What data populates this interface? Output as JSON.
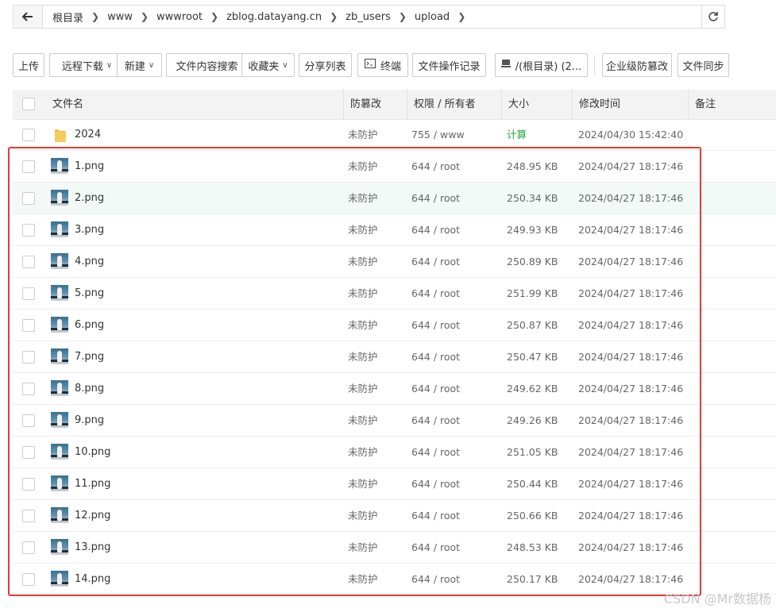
{
  "breadcrumb": {
    "items": [
      "根目录",
      "www",
      "wwwroot",
      "zblog.datayang.cn",
      "zb_users",
      "upload"
    ]
  },
  "toolbar": {
    "upload": "上传",
    "remote_download": "远程下载",
    "new": "新建",
    "content_search": "文件内容搜索",
    "favorites": "收藏夹",
    "share_list": "分享列表",
    "terminal": "终端",
    "file_op_log": "文件操作记录",
    "disk": "/(根目录) (2...",
    "enterprise_tamper": "企业级防篡改",
    "file_sync": "文件同步"
  },
  "table": {
    "headers": {
      "name": "文件名",
      "tamper": "防篡改",
      "perm": "权限 / 所有者",
      "size": "大小",
      "mtime": "修改时间",
      "note": "备注"
    },
    "rows": [
      {
        "name": "2024",
        "type": "folder",
        "tamper": "未防护",
        "perm": "755 / www",
        "size": "计算",
        "mtime": "2024/04/30 15:42:40"
      },
      {
        "name": "1.png",
        "type": "image",
        "tamper": "未防护",
        "perm": "644 / root",
        "size": "248.95 KB",
        "mtime": "2024/04/27 18:17:46"
      },
      {
        "name": "2.png",
        "type": "image",
        "tamper": "未防护",
        "perm": "644 / root",
        "size": "250.34 KB",
        "mtime": "2024/04/27 18:17:46"
      },
      {
        "name": "3.png",
        "type": "image",
        "tamper": "未防护",
        "perm": "644 / root",
        "size": "249.93 KB",
        "mtime": "2024/04/27 18:17:46"
      },
      {
        "name": "4.png",
        "type": "image",
        "tamper": "未防护",
        "perm": "644 / root",
        "size": "250.89 KB",
        "mtime": "2024/04/27 18:17:46"
      },
      {
        "name": "5.png",
        "type": "image",
        "tamper": "未防护",
        "perm": "644 / root",
        "size": "251.99 KB",
        "mtime": "2024/04/27 18:17:46"
      },
      {
        "name": "6.png",
        "type": "image",
        "tamper": "未防护",
        "perm": "644 / root",
        "size": "250.87 KB",
        "mtime": "2024/04/27 18:17:46"
      },
      {
        "name": "7.png",
        "type": "image",
        "tamper": "未防护",
        "perm": "644 / root",
        "size": "250.47 KB",
        "mtime": "2024/04/27 18:17:46"
      },
      {
        "name": "8.png",
        "type": "image",
        "tamper": "未防护",
        "perm": "644 / root",
        "size": "249.62 KB",
        "mtime": "2024/04/27 18:17:46"
      },
      {
        "name": "9.png",
        "type": "image",
        "tamper": "未防护",
        "perm": "644 / root",
        "size": "249.26 KB",
        "mtime": "2024/04/27 18:17:46"
      },
      {
        "name": "10.png",
        "type": "image",
        "tamper": "未防护",
        "perm": "644 / root",
        "size": "251.05 KB",
        "mtime": "2024/04/27 18:17:46"
      },
      {
        "name": "11.png",
        "type": "image",
        "tamper": "未防护",
        "perm": "644 / root",
        "size": "250.44 KB",
        "mtime": "2024/04/27 18:17:46"
      },
      {
        "name": "12.png",
        "type": "image",
        "tamper": "未防护",
        "perm": "644 / root",
        "size": "250.66 KB",
        "mtime": "2024/04/27 18:17:46"
      },
      {
        "name": "13.png",
        "type": "image",
        "tamper": "未防护",
        "perm": "644 / root",
        "size": "248.53 KB",
        "mtime": "2024/04/27 18:17:46"
      },
      {
        "name": "14.png",
        "type": "image",
        "tamper": "未防护",
        "perm": "644 / root",
        "size": "250.17 KB",
        "mtime": "2024/04/27 18:17:46"
      }
    ]
  },
  "watermark": "CSDN @Mr数据杨",
  "colors": {
    "accent_green": "#20a53a",
    "highlight_red": "#e53935",
    "hover_row": "#f2f9f6",
    "folder": "#f5c04a"
  }
}
